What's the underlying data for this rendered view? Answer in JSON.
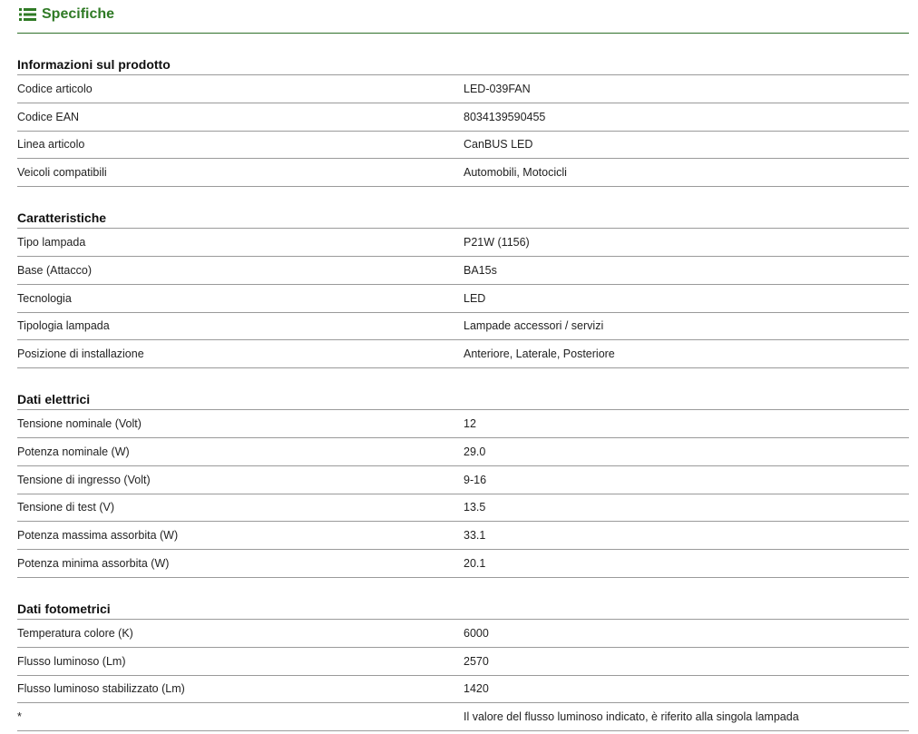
{
  "header": {
    "title": "Specifiche",
    "icon": "list-icon",
    "accent_color": "#2f7a25"
  },
  "sections": [
    {
      "title": "Informazioni sul prodotto",
      "rows": [
        {
          "label": "Codice articolo",
          "value": "LED-039FAN"
        },
        {
          "label": "Codice EAN",
          "value": "8034139590455"
        },
        {
          "label": "Linea articolo",
          "value": "CanBUS LED"
        },
        {
          "label": "Veicoli compatibili",
          "value": "Automobili, Motocicli"
        }
      ]
    },
    {
      "title": "Caratteristiche",
      "rows": [
        {
          "label": "Tipo lampada",
          "value": "P21W (1156)"
        },
        {
          "label": "Base (Attacco)",
          "value": "BA15s"
        },
        {
          "label": "Tecnologia",
          "value": "LED"
        },
        {
          "label": "Tipologia lampada",
          "value": "Lampade accessori / servizi"
        },
        {
          "label": "Posizione di installazione",
          "value": "Anteriore, Laterale, Posteriore"
        }
      ]
    },
    {
      "title": "Dati elettrici",
      "rows": [
        {
          "label": "Tensione nominale (Volt)",
          "value": "12"
        },
        {
          "label": "Potenza nominale (W)",
          "value": "29.0"
        },
        {
          "label": "Tensione di ingresso (Volt)",
          "value": "9-16"
        },
        {
          "label": "Tensione di test (V)",
          "value": "13.5"
        },
        {
          "label": "Potenza massima assorbita (W)",
          "value": "33.1"
        },
        {
          "label": "Potenza minima assorbita (W)",
          "value": "20.1"
        }
      ]
    },
    {
      "title": "Dati fotometrici",
      "rows": [
        {
          "label": "Temperatura colore (K)",
          "value": "6000"
        },
        {
          "label": "Flusso luminoso (Lm)",
          "value": "2570"
        },
        {
          "label": "Flusso luminoso stabilizzato (Lm)",
          "value": "1420"
        },
        {
          "label": "*",
          "value": "Il valore del flusso luminoso indicato, è riferito alla singola lampada"
        }
      ]
    }
  ]
}
